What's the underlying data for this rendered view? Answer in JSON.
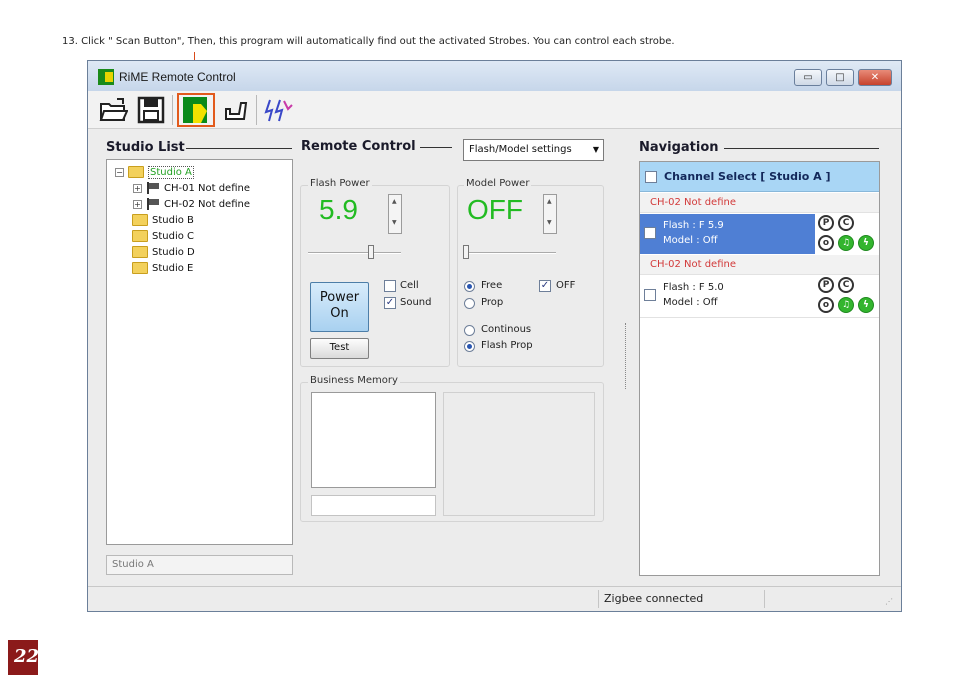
{
  "instruction": "13. Click \" Scan Button\", Then, this program will automatically find out the activated Strobes. You can control each strobe.",
  "page_number": "22",
  "window": {
    "title": "RiME Remote Control",
    "controls": [
      "minimize",
      "maximize",
      "close"
    ]
  },
  "toolbar": {
    "tools": [
      {
        "name": "open-folder-icon",
        "active": false
      },
      {
        "name": "save-icon",
        "active": false
      },
      {
        "name": "scan-icon",
        "active": true
      },
      {
        "name": "tool-icon",
        "active": false
      },
      {
        "name": "flash-icon",
        "active": false
      }
    ]
  },
  "studio_list": {
    "title": "Studio List",
    "tree": [
      {
        "label": "Studio A",
        "selected": true
      },
      {
        "label": "CH-01 Not define"
      },
      {
        "label": "CH-02 Not define"
      },
      {
        "label": "Studio B"
      },
      {
        "label": "Studio C"
      },
      {
        "label": "Studio D"
      },
      {
        "label": "Studio E"
      }
    ],
    "name_field": "Studio A"
  },
  "remote_control": {
    "title": "Remote Control",
    "mode_select": "Flash/Model settings",
    "flash_power": {
      "label": "Flash Power",
      "value": "5.9"
    },
    "model_power": {
      "label": "Model Power",
      "value": "OFF"
    },
    "power_button": {
      "line1": "Power",
      "line2": "On"
    },
    "cell_label": "Cell",
    "cell_checked": false,
    "sound_label": "Sound",
    "sound_checked": true,
    "test_label": "Test",
    "free_label": "Free",
    "prop_label": "Prop",
    "off_label": "OFF",
    "off_checked": true,
    "continous_label": "Continous",
    "flash_prop_label": "Flash Prop",
    "business_memory_label": "Business Memory"
  },
  "navigation": {
    "title": "Navigation",
    "header": "Channel Select [ Studio A ]",
    "channels": [
      {
        "name": "CH-02  Not define",
        "flash": "Flash : F 5.9",
        "model": "Model : Off",
        "selected": true
      },
      {
        "name": "CH-02  Not define",
        "flash": "Flash : F 5.0",
        "model": "Model : Off",
        "selected": false
      }
    ]
  },
  "status": {
    "connection": "Zigbee connected"
  },
  "colors": {
    "accent_green": "#22bb22",
    "scan_highlight": "#e25a1c",
    "nav_selected": "#4f7fd4",
    "nav_header": "#a9d6f5",
    "channel_red": "#d23a3a"
  }
}
